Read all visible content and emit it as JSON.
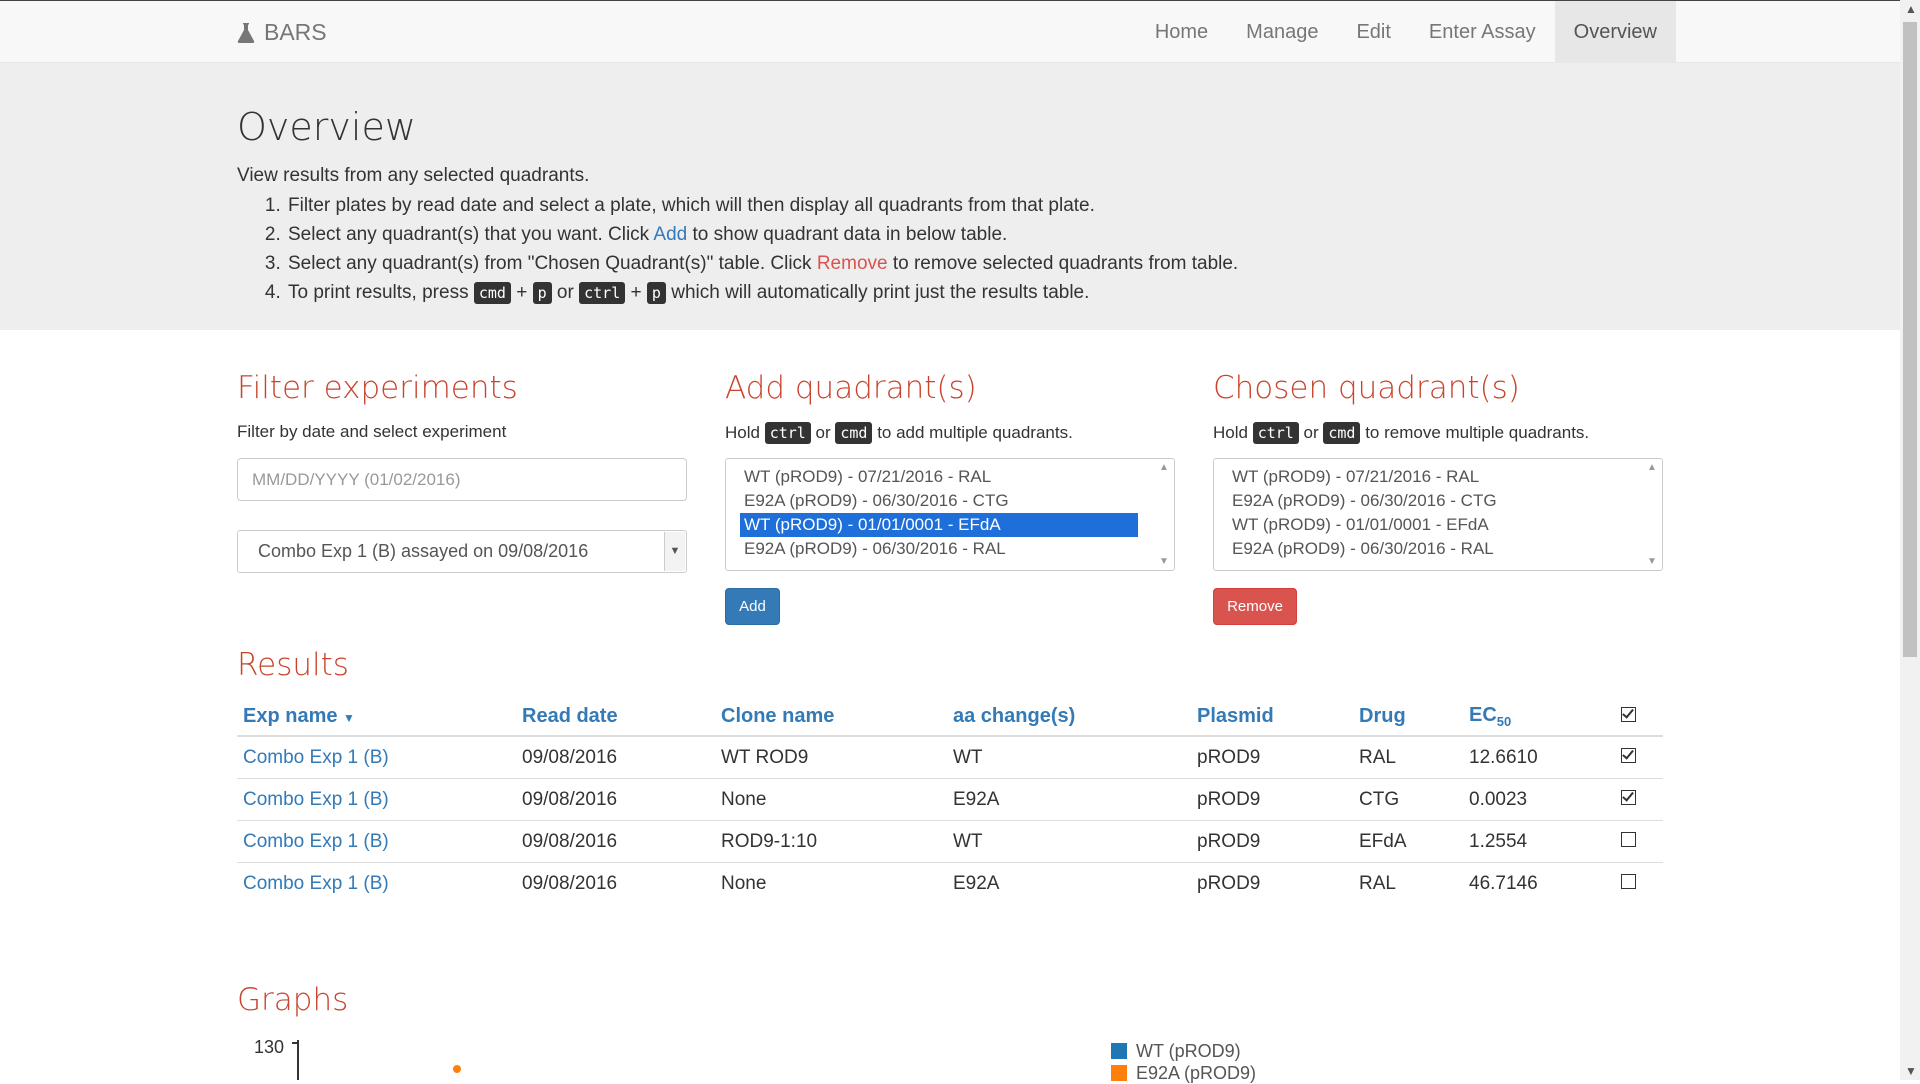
{
  "navbar": {
    "brand": "BARS",
    "items": [
      {
        "label": "Home"
      },
      {
        "label": "Manage"
      },
      {
        "label": "Edit"
      },
      {
        "label": "Enter Assay"
      },
      {
        "label": "Overview"
      }
    ],
    "active": "Overview"
  },
  "jumbotron": {
    "title": "Overview",
    "lead": "View results from any selected quadrants.",
    "step1": "Filter plates by read date and select a plate, which will then display all quadrants from that plate.",
    "step2_pre": "Select any quadrant(s) that you want. Click ",
    "step2_link": "Add",
    "step2_post": " to show quadrant data in below table.",
    "step3_pre": "Select any quadrant(s) from \"Chosen Quadrant(s)\" table. Click ",
    "step3_link": "Remove",
    "step3_post": " to remove selected quadrants from table.",
    "step4_pre": "To print results, press ",
    "step4_post": " which will automatically print just the results table.",
    "kbd_cmd": "cmd",
    "kbd_p": "p",
    "kbd_ctrl": "ctrl",
    "plus": "+",
    "or": "or"
  },
  "filter": {
    "title": "Filter experiments",
    "hint": "Filter by date and select experiment",
    "date_placeholder": "MM/DD/YYYY (01/02/2016)",
    "selected_experiment": "Combo Exp 1 (B) assayed on 09/08/2016"
  },
  "add": {
    "title": "Add quadrant(s)",
    "hint_pre": "Hold ",
    "hint_mid": " or ",
    "hint_post": " to add multiple quadrants.",
    "options": [
      {
        "label": "WT (pROD9) - 07/21/2016 - RAL"
      },
      {
        "label": "E92A (pROD9) - 06/30/2016 - CTG"
      },
      {
        "label": "WT (pROD9) - 01/01/0001 - EFdA"
      },
      {
        "label": "E92A (pROD9) - 06/30/2016 - RAL"
      }
    ],
    "selected_index": 2,
    "button": "Add"
  },
  "chosen": {
    "title": "Chosen quadrant(s)",
    "hint_pre": "Hold ",
    "hint_mid": " or ",
    "hint_post": " to remove multiple quadrants.",
    "options": [
      {
        "label": "WT (pROD9) - 07/21/2016 - RAL"
      },
      {
        "label": "E92A (pROD9) - 06/30/2016 - CTG"
      },
      {
        "label": "WT (pROD9) - 01/01/0001 - EFdA"
      },
      {
        "label": "E92A (pROD9) - 06/30/2016 - RAL"
      }
    ],
    "button": "Remove"
  },
  "results": {
    "title": "Results",
    "columns": {
      "exp_name": "Exp name",
      "read_date": "Read date",
      "clone_name": "Clone name",
      "aa_change": "aa change(s)",
      "plasmid": "Plasmid",
      "drug": "Drug",
      "ec_base": "EC",
      "ec_sub": "50"
    },
    "rows": [
      {
        "exp": "Combo Exp 1 (B)",
        "date": "09/08/2016",
        "clone": "WT ROD9",
        "aa": "WT",
        "plasmid": "pROD9",
        "drug": "RAL",
        "ec50": "12.6610",
        "checked": true
      },
      {
        "exp": "Combo Exp 1 (B)",
        "date": "09/08/2016",
        "clone": "None",
        "aa": "E92A",
        "plasmid": "pROD9",
        "drug": "CTG",
        "ec50": "0.0023",
        "checked": true
      },
      {
        "exp": "Combo Exp 1 (B)",
        "date": "09/08/2016",
        "clone": "ROD9-1:10",
        "aa": "WT",
        "plasmid": "pROD9",
        "drug": "EFdA",
        "ec50": "1.2554",
        "checked": false
      },
      {
        "exp": "Combo Exp 1 (B)",
        "date": "09/08/2016",
        "clone": "None",
        "aa": "E92A",
        "plasmid": "pROD9",
        "drug": "RAL",
        "ec50": "46.7146",
        "checked": false
      }
    ]
  },
  "graphs": {
    "title": "Graphs",
    "y_tick_top": "130",
    "legend": [
      {
        "label": "WT (pROD9)",
        "color": "#1f77b4"
      },
      {
        "label": "E92A (pROD9)",
        "color": "#ff7f0e"
      }
    ]
  },
  "colors": {
    "link": "#337ab7",
    "heading": "#c9442c",
    "remove": "#d9534f",
    "select_highlight": "#1e6fd9"
  }
}
